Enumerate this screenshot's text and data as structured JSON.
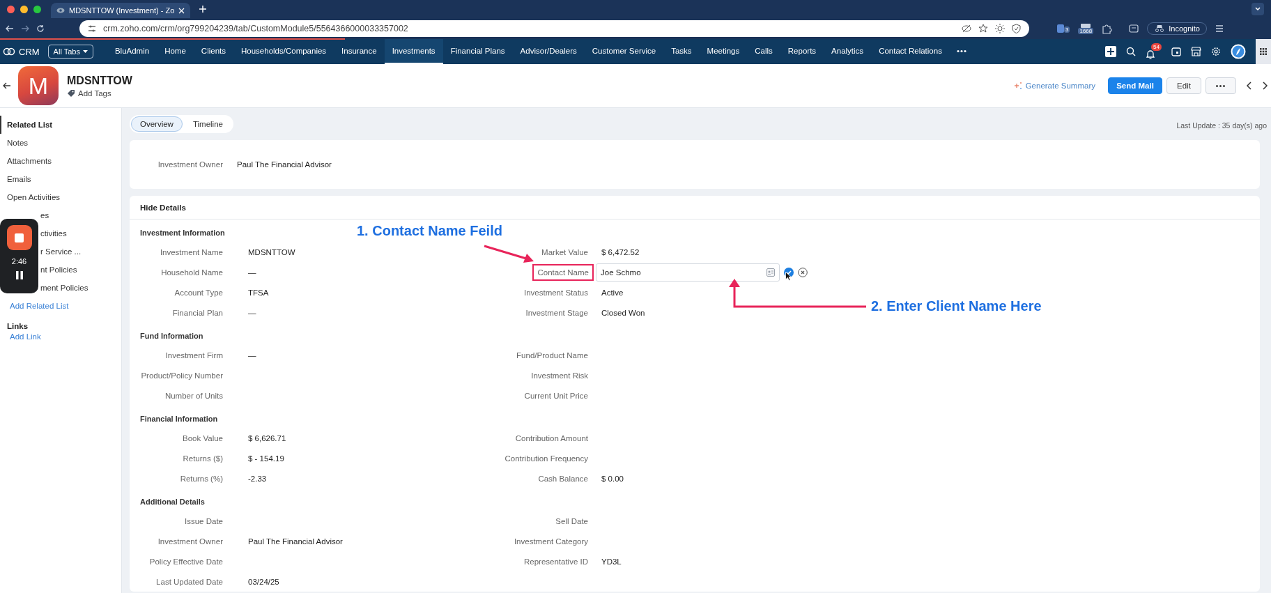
{
  "browser": {
    "tab_title": "MDSNTTOW (Investment) - Zo",
    "address": "crm.zoho.com/crm/org799204239/tab/CustomModule5/5564366000033357002",
    "extension_badges": [
      "3",
      "1668"
    ],
    "profile_label": "Incognito"
  },
  "app": {
    "logo": "CRM",
    "all_tabs": "All Tabs",
    "more": "•••",
    "notification_count": "54",
    "nav": [
      {
        "label": "BluAdmin",
        "selected": false
      },
      {
        "label": "Home",
        "selected": false
      },
      {
        "label": "Clients",
        "selected": false
      },
      {
        "label": "Households/Companies",
        "selected": false
      },
      {
        "label": "Insurance",
        "selected": false
      },
      {
        "label": "Investments",
        "selected": true
      },
      {
        "label": "Financial Plans",
        "selected": false
      },
      {
        "label": "Advisor/Dealers",
        "selected": false
      },
      {
        "label": "Customer Service",
        "selected": false
      },
      {
        "label": "Tasks",
        "selected": false
      },
      {
        "label": "Meetings",
        "selected": false
      },
      {
        "label": "Calls",
        "selected": false
      },
      {
        "label": "Reports",
        "selected": false
      },
      {
        "label": "Analytics",
        "selected": false
      },
      {
        "label": "Contact Relations",
        "selected": false
      }
    ]
  },
  "record": {
    "avatar_letter": "M",
    "name": "MDSNTTOW",
    "add_tags": "Add Tags",
    "generate_summary": "Generate Summary",
    "send_mail": "Send Mail",
    "edit": "Edit",
    "more": "•••"
  },
  "sidebar": {
    "title": "Related List",
    "add_related": "Add Related List",
    "links_title": "Links",
    "add_link": "Add Link",
    "items": [
      "Notes",
      "Attachments",
      "Emails",
      "Open Activities"
    ],
    "items_behind_recorder": [
      "es",
      "ctivities",
      "r Service ...",
      "nt Policies",
      "ment Policies"
    ]
  },
  "view_tabs": [
    {
      "label": "Overview",
      "selected": true
    },
    {
      "label": "Timeline",
      "selected": false
    }
  ],
  "last_update": "Last Update : 35 day(s) ago",
  "owner_card": {
    "label": "Investment Owner",
    "value": "Paul The Financial Advisor"
  },
  "details": {
    "toggle": "Hide Details",
    "sections": [
      {
        "title": "Investment Information",
        "rows": [
          [
            {
              "label": "Investment Name",
              "value": "MDSNTTOW"
            },
            {
              "label": "Market Value",
              "value": "$ 6,472.52"
            }
          ],
          [
            {
              "label": "Household Name",
              "value": "—"
            },
            {
              "label": "Contact Name",
              "value": "Joe Schmo",
              "kind": "edit",
              "boxed": true
            }
          ],
          [
            {
              "label": "Account Type",
              "value": "TFSA"
            },
            {
              "label": "Investment Status",
              "value": "Active"
            }
          ],
          [
            {
              "label": "Financial Plan",
              "value": "—"
            },
            {
              "label": "Investment Stage",
              "value": "Closed Won"
            }
          ]
        ]
      },
      {
        "title": "Fund Information",
        "rows": [
          [
            {
              "label": "Investment Firm",
              "value": "—"
            },
            {
              "label": "Fund/Product Name"
            }
          ],
          [
            {
              "label": "Product/Policy Number"
            },
            {
              "label": "Investment Risk"
            }
          ],
          [
            {
              "label": "Number of Units"
            },
            {
              "label": "Current Unit Price"
            }
          ]
        ]
      },
      {
        "title": "Financial Information",
        "rows": [
          [
            {
              "label": "Book Value",
              "value": "$ 6,626.71"
            },
            {
              "label": "Contribution Amount"
            }
          ],
          [
            {
              "label": "Returns ($)",
              "value": "$ - 154.19"
            },
            {
              "label": "Contribution Frequency"
            }
          ],
          [
            {
              "label": "Returns (%)",
              "value": "-2.33"
            },
            {
              "label": "Cash Balance",
              "value": "$ 0.00"
            }
          ]
        ]
      },
      {
        "title": "Additional Details",
        "rows": [
          [
            {
              "label": "Issue Date"
            },
            {
              "label": "Sell Date"
            }
          ],
          [
            {
              "label": "Investment Owner",
              "value": "Paul The Financial Advisor"
            },
            {
              "label": "Investment Category"
            }
          ],
          [
            {
              "label": "Policy Effective Date"
            },
            {
              "label": "Representative ID",
              "value": "YD3L"
            }
          ],
          [
            {
              "label": "Last Updated Date",
              "value": "03/24/25"
            }
          ]
        ]
      }
    ]
  },
  "recorder": {
    "time": "2:46"
  },
  "annotations": [
    {
      "text": "1. Contact Name Feild"
    },
    {
      "text": "2. Enter Client Name Here"
    }
  ]
}
